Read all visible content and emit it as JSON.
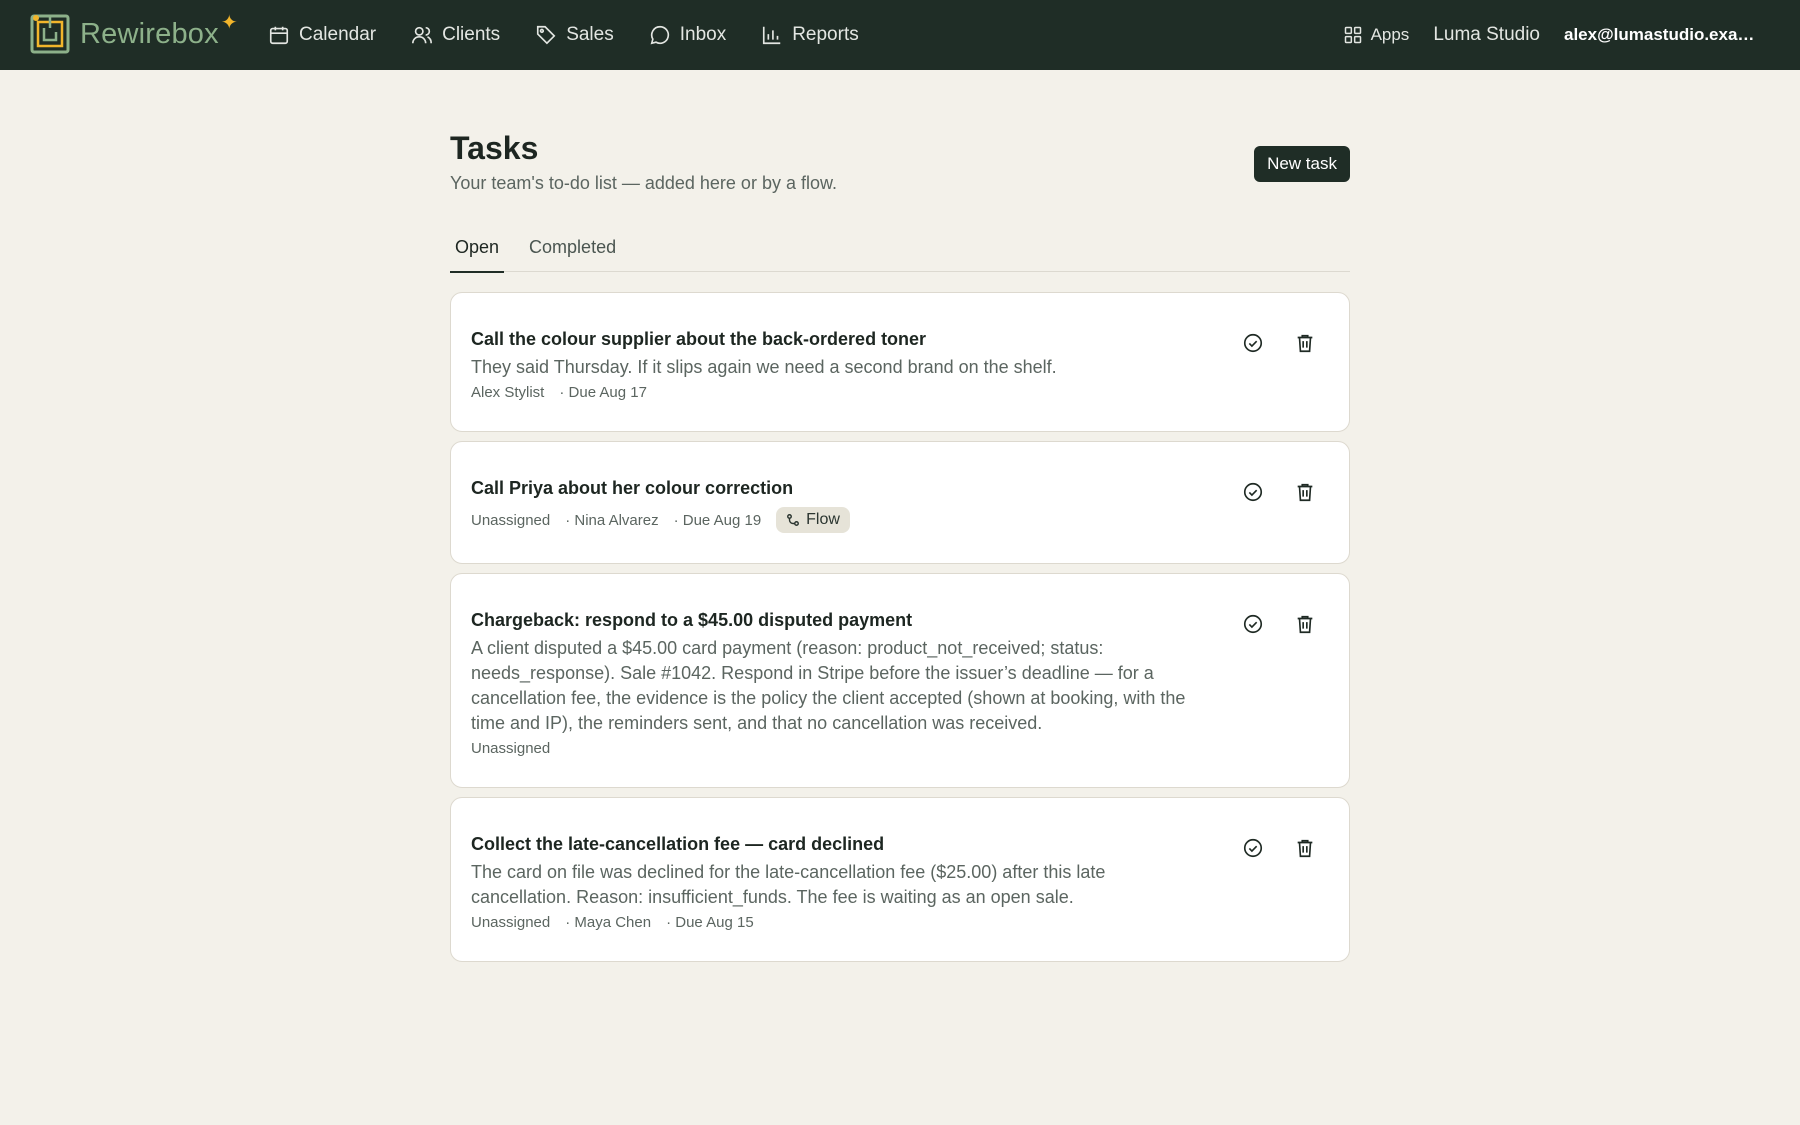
{
  "app": {
    "brand": "Rewirebox",
    "nav": [
      {
        "label": "Calendar",
        "icon": "calendar-icon"
      },
      {
        "label": "Clients",
        "icon": "users-icon"
      },
      {
        "label": "Sales",
        "icon": "tag-icon"
      },
      {
        "label": "Inbox",
        "icon": "chat-bubble-icon"
      },
      {
        "label": "Reports",
        "icon": "bar-chart-icon"
      }
    ],
    "apps_label": "Apps",
    "studio": "Luma Studio",
    "account": "alex@lumastudio.example.com"
  },
  "page": {
    "title": "Tasks",
    "subtitle": "Your team's to-do list — added here or by a flow.",
    "new_task_label": "New task",
    "tabs": [
      {
        "label": "Open",
        "active": true
      },
      {
        "label": "Completed",
        "active": false
      }
    ]
  },
  "tasks": [
    {
      "title": "Call the colour supplier about the back-ordered toner",
      "description": "They said Thursday. If it slips again we need a second brand on the shelf.",
      "assignee": "Alex Stylist",
      "client": "",
      "due": "· Due Aug 17",
      "flow": ""
    },
    {
      "title": "Call Priya about her colour correction",
      "description": "",
      "assignee": "Unassigned",
      "client": "· Nina Alvarez",
      "due": "· Due Aug 19",
      "flow": "Flow"
    },
    {
      "title": "Chargeback: respond to a $45.00 disputed payment",
      "description": "A client disputed a $45.00 card payment (reason: product_not_received; status: needs_response). Sale #1042. Respond in Stripe before the issuer’s deadline — for a cancellation fee, the evidence is the policy the client accepted (shown at booking, with the time and IP), the reminders sent, and that no cancellation was received.",
      "assignee": "Unassigned",
      "client": "",
      "due": "",
      "flow": ""
    },
    {
      "title": "Collect the late-cancellation fee — card declined",
      "description": "The card on file was declined for the late-cancellation fee ($25.00) after this late cancellation. Reason: insufficient_funds. The fee is waiting as an open sale.",
      "assignee": "Unassigned",
      "client": "· Maya Chen",
      "due": "· Due Aug 15",
      "flow": ""
    }
  ],
  "colors": {
    "topbar": "#1f2d26",
    "background": "#f3f1ea",
    "brand_green": "#8db18a",
    "brand_spark": "#f2b52b"
  }
}
